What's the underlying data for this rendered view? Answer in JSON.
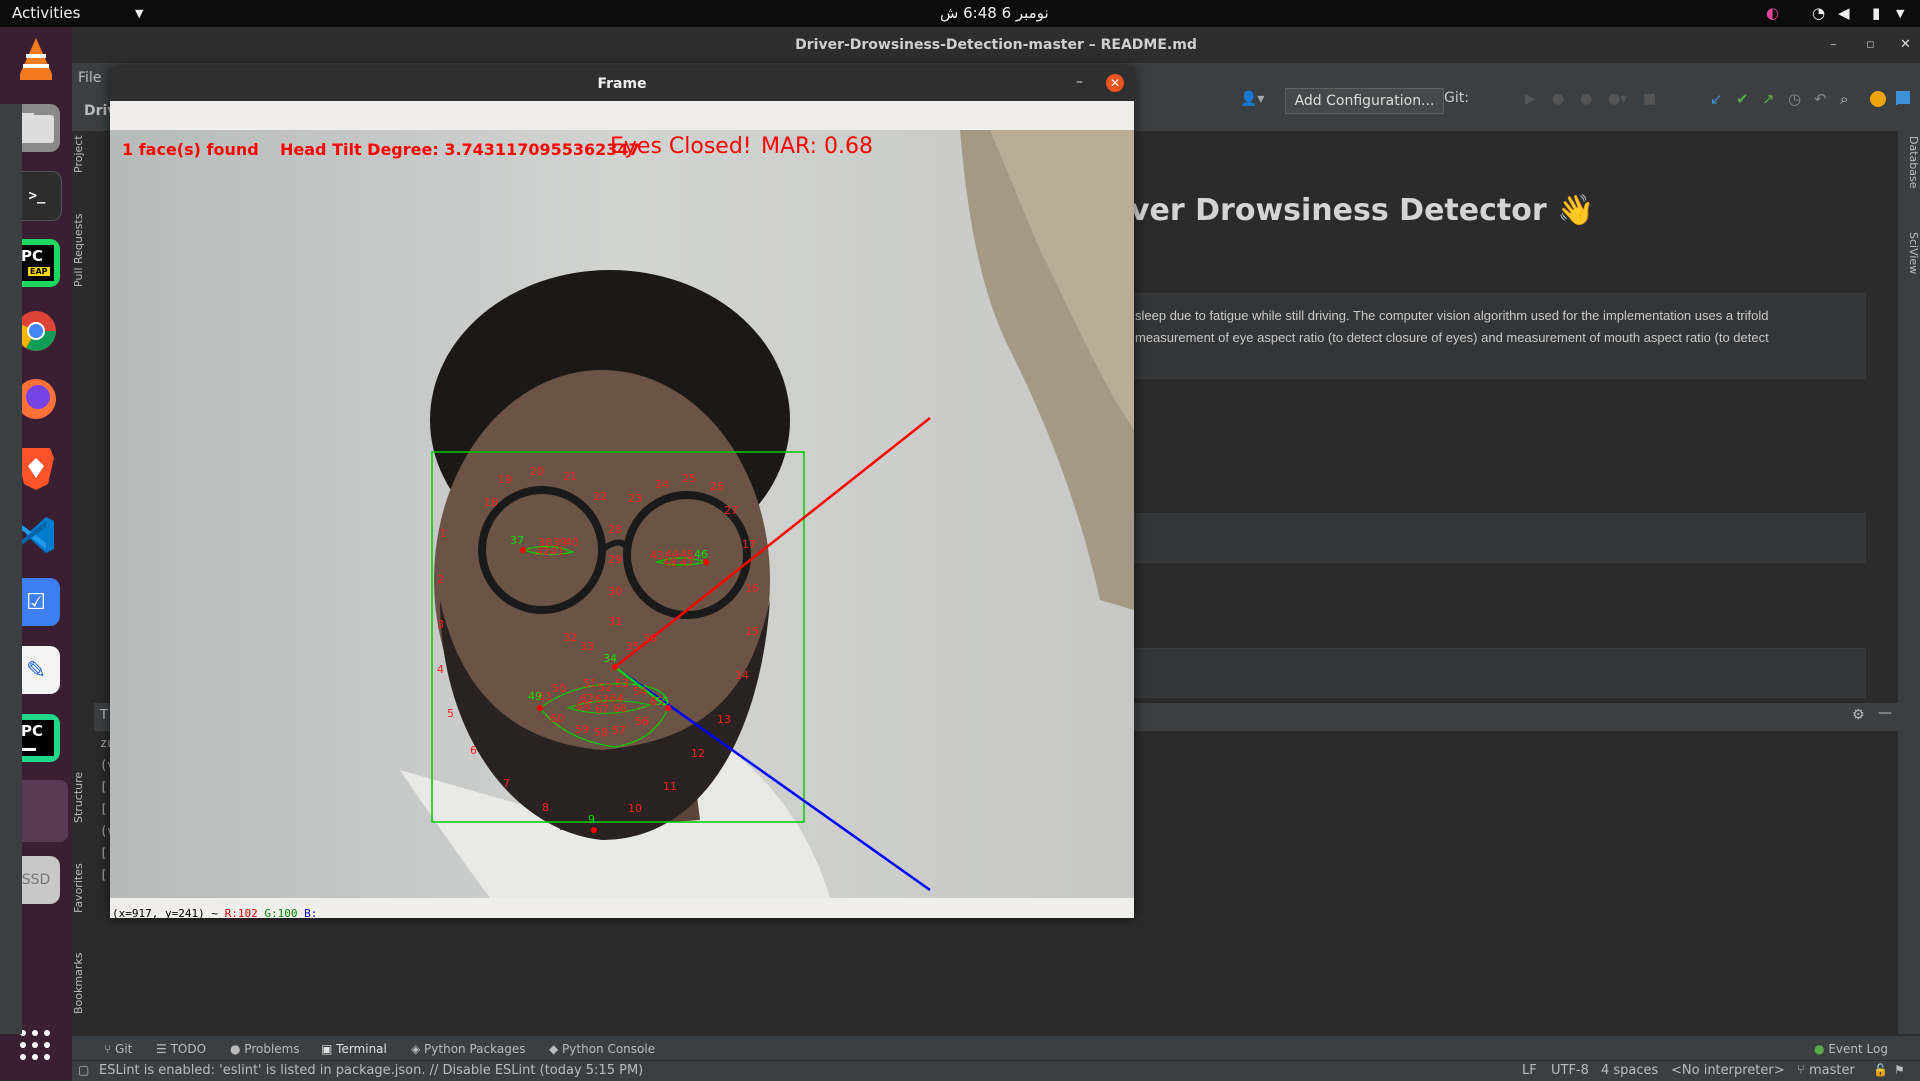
{
  "topbar": {
    "activities": "Activities",
    "clock": "نومبر 6  6:48 ش"
  },
  "dock": {
    "items": [
      "vlc-icon",
      "files-icon",
      "terminal-icon",
      "pycharm-eap-icon",
      "chrome-icon",
      "firefox-icon",
      "brave-icon",
      "vscode-icon",
      "todo-icon",
      "text-editor-icon",
      "pycharm-icon",
      "active-app-icon",
      "ssd-drive-icon",
      "app-grid-icon"
    ],
    "pycharm_eap_label": "PC",
    "pycharm_eap_badge": "EAP",
    "pycharm_label": "PC",
    "ssd_label": "SSD"
  },
  "ide": {
    "title": "Driver-Drowsiness-Detection-master – README.md",
    "menu_file": "File",
    "breadcrumb": "Driv",
    "add_configuration": "Add Configuration...",
    "git_label": "Git:",
    "left_tabs": [
      "Project",
      "Pull Requests",
      "Structure",
      "Favorites",
      "Bookmarks"
    ],
    "right_tabs": [
      "Database",
      "SciView"
    ],
    "terminal_tab_letter": "T",
    "terminal_lines": [
      "zu",
      "(v",
      "[",
      "[",
      "(v",
      "[",
      "["
    ]
  },
  "markdown": {
    "heading": "ver Drowsiness Detector 👋",
    "paragraph": "sleep due to fatigue while still driving. The computer vision algorithm used for the implementation uses a trifold measurement of eye aspect ratio (to detect closure of eyes) and measurement of mouth aspect ratio (to detect"
  },
  "bottom_tools": [
    "Git",
    "TODO",
    "Problems",
    "Terminal",
    "Python Packages",
    "Python Console"
  ],
  "event_log": "Event Log",
  "status": {
    "message": "ESLint is enabled: 'eslint' is listed in package.json. // Disable ESLint (today 5:15 PM)",
    "line_sep": "LF",
    "encoding": "UTF-8",
    "indent": "4 spaces",
    "interpreter": "<No interpreter>",
    "branch": "master"
  },
  "frame": {
    "title": "Frame",
    "overlay_faces": "1 face(s) found",
    "overlay_tilt": "Head Tilt Degree: 3.7431170955362347",
    "overlay_eyes": "Eyes Closed!",
    "overlay_mar": "MAR: 0.68",
    "coord_prefix": "(x=917, y=241) ~",
    "coord_r": "R:102",
    "coord_g": "G:100",
    "coord_b": "B:"
  },
  "colors": {
    "accent": "#e95420",
    "overlay_red": "#ff0000",
    "landmark_green": "#00cc00",
    "axis_blue": "#0000ff"
  }
}
